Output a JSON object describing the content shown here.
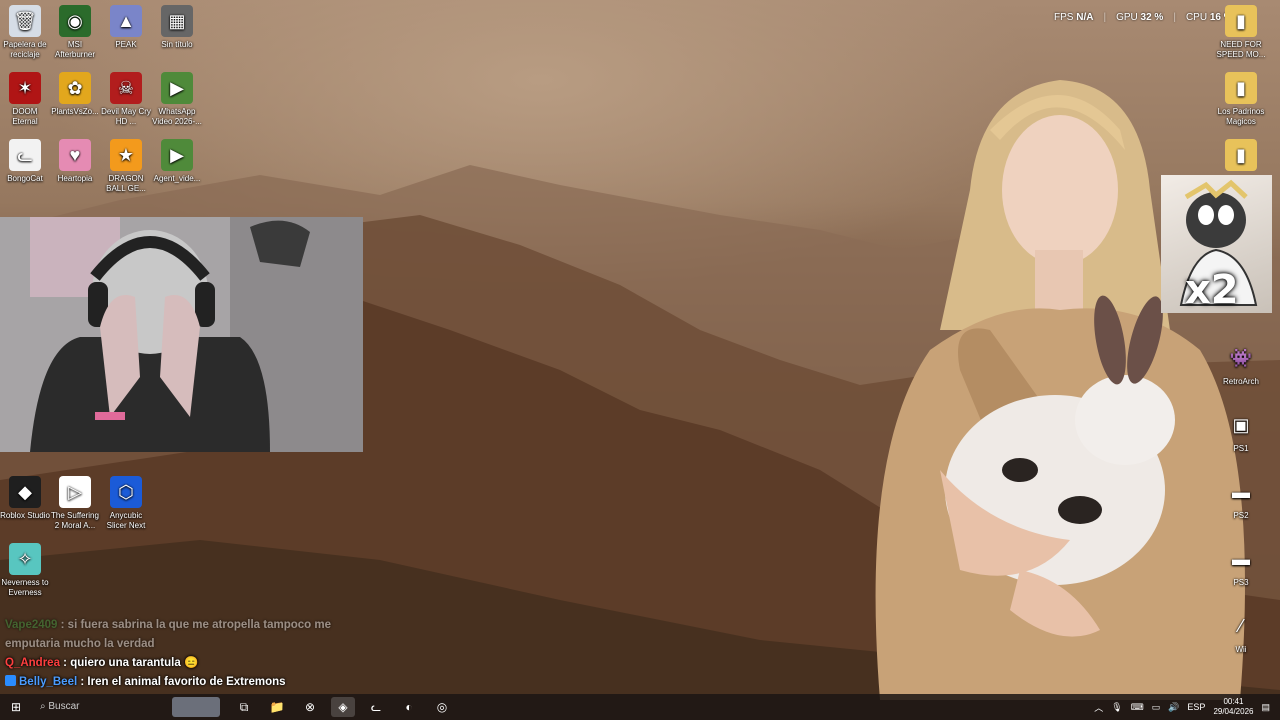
{
  "overlay": {
    "fps_label": "FPS",
    "fps_value": "N/A",
    "gpu_label": "GPU",
    "gpu_value": "32 %",
    "cpu_label": "CPU",
    "cpu_value": "16 %"
  },
  "desktop_left": [
    {
      "label": "Papelera de reciclaje",
      "icon": "recycle-bin-icon",
      "color": "#d6dde6",
      "glyph": "🗑"
    },
    {
      "label": "MSI Afterburner",
      "icon": "msi-afterburner-icon",
      "color": "#2b6b2b",
      "glyph": "◉"
    },
    {
      "label": "PEAK",
      "icon": "peak-icon",
      "color": "#7a85c9",
      "glyph": "▲"
    },
    {
      "label": "Sin título",
      "icon": "image-file-icon",
      "color": "#666666",
      "glyph": "▦"
    },
    {
      "label": "DOOM Eternal",
      "icon": "doom-icon",
      "color": "#b01515",
      "glyph": "✶"
    },
    {
      "label": "PlantsVsZo...",
      "icon": "plants-vs-zombies-icon",
      "color": "#e2a71d",
      "glyph": "✿"
    },
    {
      "label": "Devil May Cry HD ...",
      "icon": "devil-may-cry-icon",
      "color": "#b21d1d",
      "glyph": "☠"
    },
    {
      "label": "WhatsApp Video 2026-...",
      "icon": "video-file-icon",
      "color": "#4f8a3a",
      "glyph": "▶"
    },
    {
      "label": "BongoCat",
      "icon": "bongocat-icon",
      "color": "#f2f2f2",
      "glyph": "ᓚ"
    },
    {
      "label": "Heartopia",
      "icon": "heartopia-icon",
      "color": "#e58bb3",
      "glyph": "♥"
    },
    {
      "label": "DRAGON BALL GE...",
      "icon": "dragon-ball-icon",
      "color": "#f39a1c",
      "glyph": "★"
    },
    {
      "label": "Agent_vide...",
      "icon": "video-file-icon",
      "color": "#4f8a3a",
      "glyph": "▶"
    },
    {
      "label": "Roblox Studio",
      "icon": "roblox-studio-icon",
      "color": "#1f1f1f",
      "glyph": "◆"
    },
    {
      "label": "The Suffering 2 Moral A...",
      "icon": "suffering-icon",
      "color": "#ffffff",
      "glyph": "▷"
    },
    {
      "label": "Anycubic Slicer Next",
      "icon": "anycubic-icon",
      "color": "#1b5bd8",
      "glyph": "⬡"
    },
    {
      "label": "Neverness to Everness",
      "icon": "neverness-icon",
      "color": "#58c6c0",
      "glyph": "✧"
    }
  ],
  "desktop_right": [
    {
      "label": "NEED FOR SPEED MO...",
      "icon": "folder-icon",
      "color": "#e8c25a",
      "glyph": "▮"
    },
    {
      "label": "Los Padrinos Magicos",
      "icon": "folder-icon",
      "color": "#e8c25a",
      "glyph": "▮"
    },
    {
      "label": "",
      "icon": "folder-icon",
      "color": "#e8c25a",
      "glyph": "▮"
    },
    {
      "label": "RetroArch",
      "icon": "retroarch-icon",
      "color": "transparent",
      "glyph": "👾"
    },
    {
      "label": "PS1",
      "icon": "ps1-icon",
      "color": "transparent",
      "glyph": "▣"
    },
    {
      "label": "PS2",
      "icon": "ps2-icon",
      "color": "transparent",
      "glyph": "▬"
    },
    {
      "label": "PS3",
      "icon": "ps3-icon",
      "color": "transparent",
      "glyph": "▬"
    },
    {
      "label": "Wii",
      "icon": "wii-remote-icon",
      "color": "transparent",
      "glyph": "⁄"
    }
  ],
  "sticker": {
    "text": "x2"
  },
  "chat": [
    {
      "user": "Vape2409",
      "sep": " : ",
      "message": "si fuera sabrina la que me atropella tampoco me emputaria mucho la verdad",
      "color": "green",
      "faded": true
    },
    {
      "user": "Q_Andrea",
      "sep": " : ",
      "message": "quiero una tarantula 😑",
      "color": "red",
      "faded": false
    },
    {
      "user": "Belly_Beel",
      "sep": " : ",
      "message": "Iren el animal favorito de Extremons",
      "color": "blue",
      "faded": false
    }
  ],
  "taskbar": {
    "start": "⊞",
    "search": "Buscar",
    "apps": [
      {
        "name": "task-view-icon",
        "glyph": "⧉"
      },
      {
        "name": "file-explorer-icon",
        "glyph": "📁"
      },
      {
        "name": "xbox-icon",
        "glyph": "⊗"
      },
      {
        "name": "brave-browser-icon",
        "glyph": "◈"
      },
      {
        "name": "bongocat-taskbar-icon",
        "glyph": "ᓚ"
      },
      {
        "name": "discord-icon",
        "glyph": "◐"
      },
      {
        "name": "obs-icon",
        "glyph": "◎"
      }
    ],
    "language": "ESP",
    "time": "00:41",
    "date": "29/04/2026"
  }
}
